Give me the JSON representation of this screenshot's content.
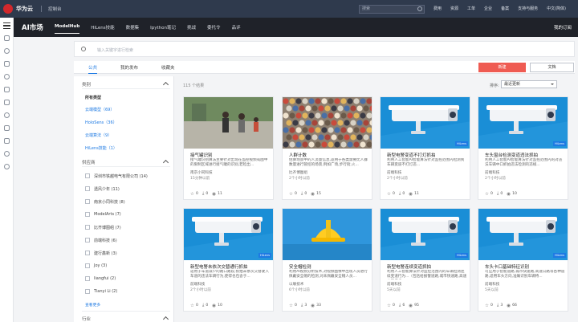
{
  "topbar": {
    "brand": "华为云",
    "console": "控制台",
    "search_placeholder": "搜索",
    "links": [
      "费用",
      "资源",
      "工单",
      "企业",
      "备案",
      "支持与服务",
      "中文(简体)"
    ]
  },
  "subnav": {
    "title": "AI市场",
    "items": [
      "ModelHub",
      "HiLens技能",
      "数据集",
      "Ipython笔记",
      "挑战",
      "委托令",
      "品评"
    ],
    "active": "ModelHub",
    "right": "我的订阅"
  },
  "search": {
    "placeholder": "输入关键字进行检索"
  },
  "tabs": [
    {
      "label": "公共"
    },
    {
      "label": "我的发布"
    },
    {
      "label": "收藏夹"
    }
  ],
  "buttons": {
    "new": "新建",
    "doc": "文档"
  },
  "filter": {
    "category_title": "类别",
    "categories": [
      {
        "label": "所有类型"
      },
      {
        "label": "云端模型（69）"
      },
      {
        "label": "HoloSens（36）"
      },
      {
        "label": "云端算法（9）"
      },
      {
        "label": "HiLens技能（1）"
      }
    ],
    "vendor_title": "供应商",
    "vendors": [
      {
        "label": "深圳市铁越电气有限公司 (14)"
      },
      {
        "label": "透风少年 (11)"
      },
      {
        "label": "南京小同科技 (8)"
      },
      {
        "label": "ModelArts (7)"
      },
      {
        "label": "比齐博图组 (7)"
      },
      {
        "label": "前端科技 (6)"
      },
      {
        "label": "建行鑫新 (3)"
      },
      {
        "label": "Joy (3)"
      },
      {
        "label": "liangfui (2)"
      },
      {
        "label": "Tianyi Li (2)"
      }
    ],
    "more": "查看更多",
    "industry_title": "行业"
  },
  "list": {
    "count": "115 个结果",
    "sort_label": "排序:",
    "sort_value": "最近更新"
  },
  "cards": [
    {
      "name": "接气罐识别",
      "desc": "接气罐识别算法主要针对出现在监控视频或图中的限制区域进行接气罐的识别,若检出...",
      "author": "南京小同科技",
      "time": "15分钟以前",
      "stars": "0",
      "downloads": "0",
      "views": "11",
      "img": "photo-street"
    },
    {
      "name": "人群计数",
      "desc": "估算场景中的人流量信息,适用于各类需要比人群数量进行管控的场景,例如广场,步行街,火...",
      "author": "比齐博图组",
      "time": "2个小时以前",
      "stars": "0",
      "downloads": "0",
      "views": "15",
      "img": "photo-crowd"
    },
    {
      "name": "新型电警变道不打灯抓拍",
      "desc": "利用人工智能AI智能算法针对监控范围内检测到车辆变道不打灯违...",
      "author": "前端科技",
      "time": "2个小时以前",
      "stars": "0",
      "downloads": "0",
      "views": "11",
      "img": "camera"
    },
    {
      "name": "车头窗台检测变道违法抓拍",
      "desc": "利用人工智能AI智能算法针对监控范围内的对违法车辆中口抓拍违法检测的违规...",
      "author": "前端科技",
      "time": "2个小时以前",
      "stars": "0",
      "downloads": "0",
      "views": "10",
      "img": "camera"
    },
    {
      "name": "新型电警未依次交替通行抓拍",
      "desc": "适用于车道减少的路口路段,抓拍未依次交替驶入车道的违法车辆行为,使得也包含于...",
      "author": "前端科技",
      "time": "2个小时以前",
      "stars": "0",
      "downloads": "0",
      "views": "10",
      "img": "camera"
    },
    {
      "name": "安全帽检测",
      "desc": "利用AI视频分析技术,对视频图像中出现人员进行佩戴安全帽的检测,对未佩戴安全帽人员...",
      "author": "以联技术",
      "time": "6个小时以前",
      "stars": "0",
      "downloads": "3",
      "views": "33",
      "img": "helmet"
    },
    {
      "name": "新型电警连续变道抓拍",
      "desc": "利用人工智能算法针对监控范围内的车辆检测连续变道行为...（包括给报警道路,城市快速路,高速公路横卡...",
      "author": "前端科技",
      "time": "5天以前",
      "stars": "0",
      "downloads": "6",
      "views": "95",
      "img": "camera"
    },
    {
      "name": "车头卡口基础特征识别",
      "desc": "可应用于智能道路,城市快速路,高速公路等各种道路,适用车头方向,准确识别车辆特...",
      "author": "前端科技",
      "time": "5天以前",
      "stars": "0",
      "downloads": "3",
      "views": "66",
      "img": "camera"
    }
  ],
  "badge_text": "HiLens"
}
